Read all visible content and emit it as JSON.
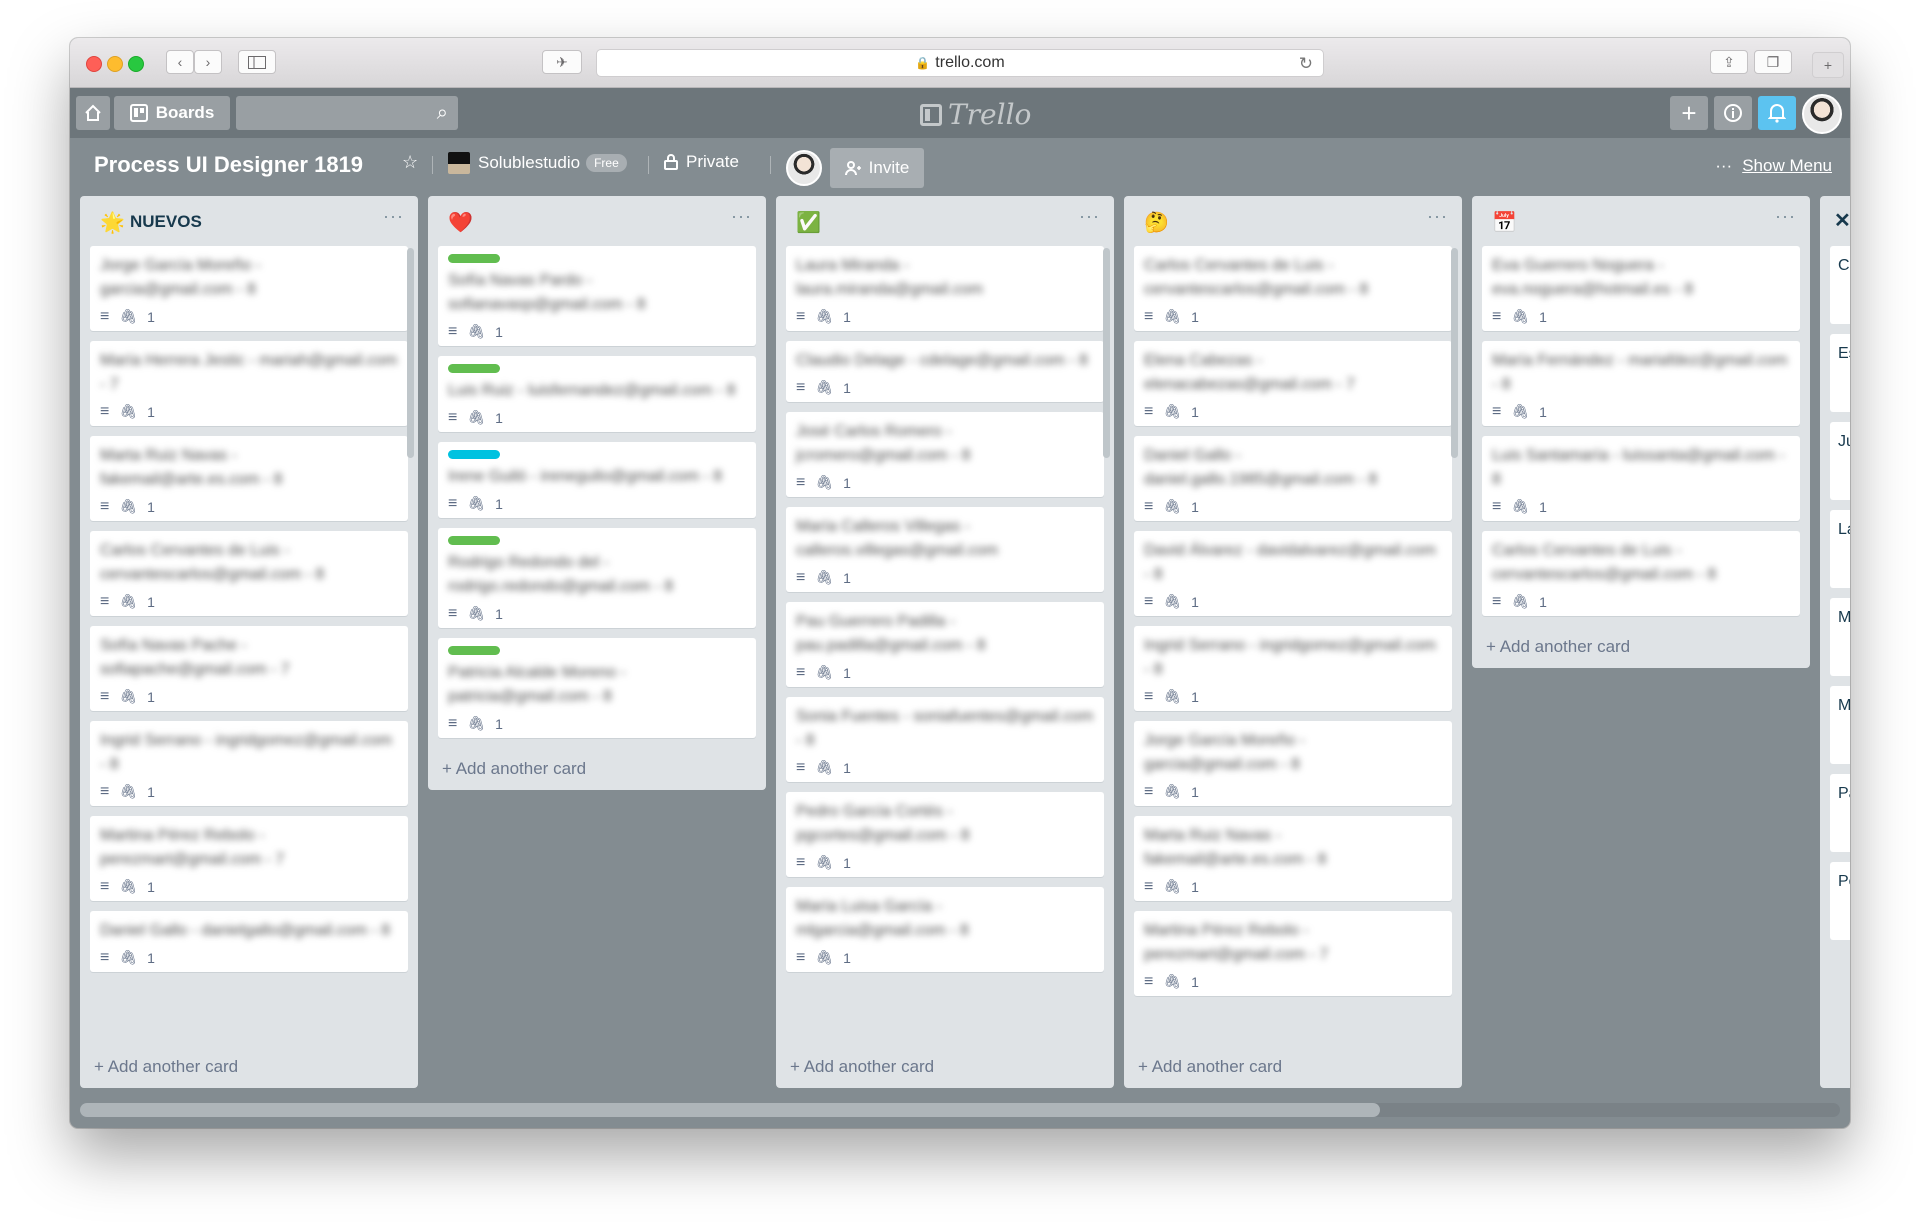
{
  "browser": {
    "url": "trello.com"
  },
  "header": {
    "boards_label": "Boards",
    "logo_text": "Trello"
  },
  "board": {
    "title": "Process UI Designer 1819",
    "team": "Solublestudio",
    "team_badge": "Free",
    "visibility": "Private",
    "invite_label": "Invite",
    "show_menu": "Show Menu"
  },
  "lists": [
    {
      "emoji": "🌟",
      "name": "NUEVOS",
      "add_label": "+ Add another card",
      "cards": [
        {
          "title": "Jorge García Moreño - garcia@gmail.com - 8",
          "badge": "1"
        },
        {
          "title": "María Herrera Jestic - mariah@gmail.com - 7",
          "badge": "1"
        },
        {
          "title": "Marta Ruiz Navas - fakemail@arte.es.com - 8",
          "badge": "1"
        },
        {
          "title": "Carlos Cervantes de Luis - cervantescarlos@gmail.com - 8",
          "badge": "1"
        },
        {
          "title": "Sofía Navas Pache - sofiapache@gmail.com - 7",
          "badge": "1"
        },
        {
          "title": "Ingrid Serrano - ingridgomez@gmail.com - 8",
          "badge": "1"
        },
        {
          "title": "Martina Pérez Rebolo - perezmart@gmail.com - 7",
          "badge": "1"
        },
        {
          "title": "Daniel Gallo - danielgallo@gmail.com - 8",
          "badge": "1"
        }
      ]
    },
    {
      "emoji": "❤️",
      "name": "",
      "add_label": "+ Add another card",
      "cards": [
        {
          "title": "Sofía Navas Pardo - sofianavasp@gmail.com - 8",
          "badge": "1",
          "label": "#61bd4f"
        },
        {
          "title": "Luis Ruiz - luisfernandez@gmail.com - 8",
          "badge": "1",
          "label": "#61bd4f"
        },
        {
          "title": "Irene Guiló - ireneguilo@gmail.com - 8",
          "badge": "1",
          "label": "#00c2e0"
        },
        {
          "title": "Rodrigo Redondo del - rodrigo.redondo@gmail.com - 8",
          "badge": "1",
          "label": "#61bd4f"
        },
        {
          "title": "Patricia Alcalde Moreno - patricia@gmail.com - 8",
          "badge": "1",
          "label": "#61bd4f"
        }
      ]
    },
    {
      "emoji": "✅",
      "name": "",
      "add_label": "+ Add another card",
      "cards": [
        {
          "title": "Laura Miranda - laura.miranda@gmail.com",
          "badge": "1"
        },
        {
          "title": "Claudio Delage - cdelage@gmail.com - 8",
          "badge": "1"
        },
        {
          "title": "José Carlos Romero - jcromero@gmail.com - 8",
          "badge": "1"
        },
        {
          "title": "María Calleros Villegas - calleros.villegas@gmail.com",
          "badge": "1"
        },
        {
          "title": "Pau Guerrero Padilla - pau.padilla@gmail.com - 8",
          "badge": "1"
        },
        {
          "title": "Sonia Fuentes - soniafuentes@gmail.com - 8",
          "badge": "1"
        },
        {
          "title": "Pedro García Cortés - pgcortes@gmail.com - 8",
          "badge": "1"
        },
        {
          "title": "María Luisa García - mlgarcia@gmail.com - 8",
          "badge": "1"
        }
      ]
    },
    {
      "emoji": "🤔",
      "name": "",
      "add_label": "+ Add another card",
      "cards": [
        {
          "title": "Carlos Cervantes de Luis - cervantescarlos@gmail.com - 8",
          "badge": "1"
        },
        {
          "title": "Elena Cabezas - elenacabezas@gmail.com - 7",
          "badge": "1"
        },
        {
          "title": "Daniel Gallo - daniel.gallo.1985@gmail.com - 8",
          "badge": "1"
        },
        {
          "title": "David Álvarez - davidalvarez@gmail.com - 8",
          "badge": "1"
        },
        {
          "title": "Ingrid Serrano - ingridgomez@gmail.com - 8",
          "badge": "1"
        },
        {
          "title": "Jorge García Moreño - garcia@gmail.com - 8",
          "badge": "1"
        },
        {
          "title": "Marta Ruiz Navas - fakemail@arte.es.com - 8",
          "badge": "1"
        },
        {
          "title": "Martina Pérez Rebolo - perezmart@gmail.com - 7",
          "badge": "1"
        }
      ]
    },
    {
      "emoji": "📅",
      "name": "",
      "add_label": "+ Add another card",
      "cards": [
        {
          "title": "Eva Guerrero Noguera - eva.noguera@hotmail.es - 8",
          "badge": "1"
        },
        {
          "title": "María Fernández - mariafdez@gmail.com - 8",
          "badge": "1"
        },
        {
          "title": "Luis Santamaría - luissanta@gmail.com - 8",
          "badge": "1"
        },
        {
          "title": "Carlos Cervantes de Luis - cervantescarlos@gmail.com - 8",
          "badge": "1"
        }
      ]
    }
  ],
  "partial_list": {
    "cards": [
      "Ca sis",
      "Es sa",
      "Ju jcr",
      "La lau",
      "Ma ca",
      "Ma mj",
      "Pa p.c",
      "Pe"
    ]
  }
}
